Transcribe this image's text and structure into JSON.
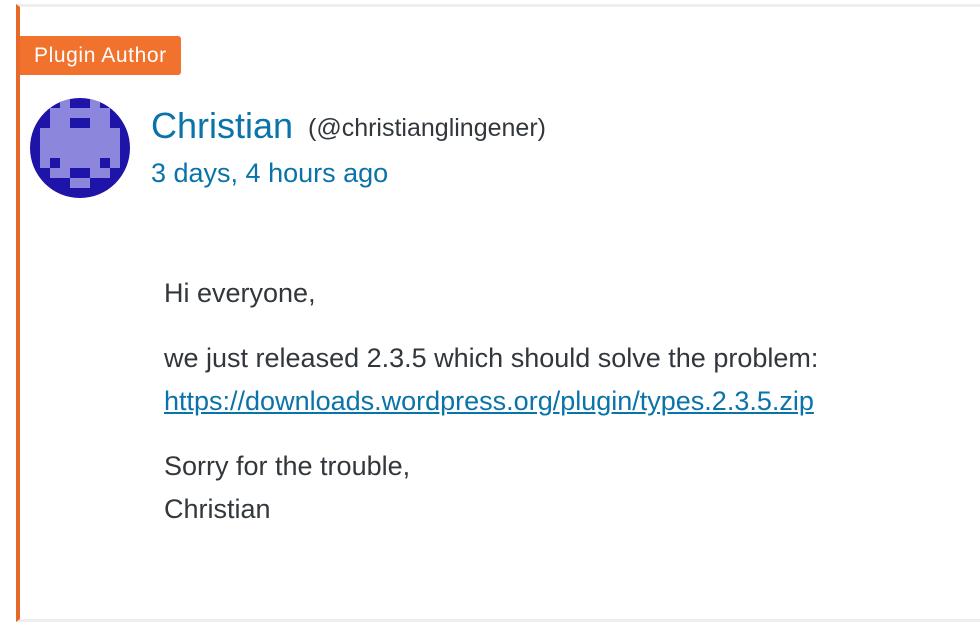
{
  "badge": {
    "label": "Plugin Author",
    "color": "#f0722c"
  },
  "author": {
    "name": "Christian",
    "handle": "(@christianglingener)",
    "avatar_icon": "pixel-invader-avatar"
  },
  "meta": {
    "timestamp": "3 days, 4 hours ago"
  },
  "content": {
    "greeting": "Hi everyone,",
    "message": "we just released 2.3.5 which should solve the problem:",
    "link": "https://downloads.wordpress.org/plugin/types.2.3.5.zip",
    "closing": "Sorry for the trouble,",
    "signature": "Christian"
  },
  "colors": {
    "accent": "#e7692a",
    "link": "#0a73aa",
    "text": "#32373c"
  }
}
